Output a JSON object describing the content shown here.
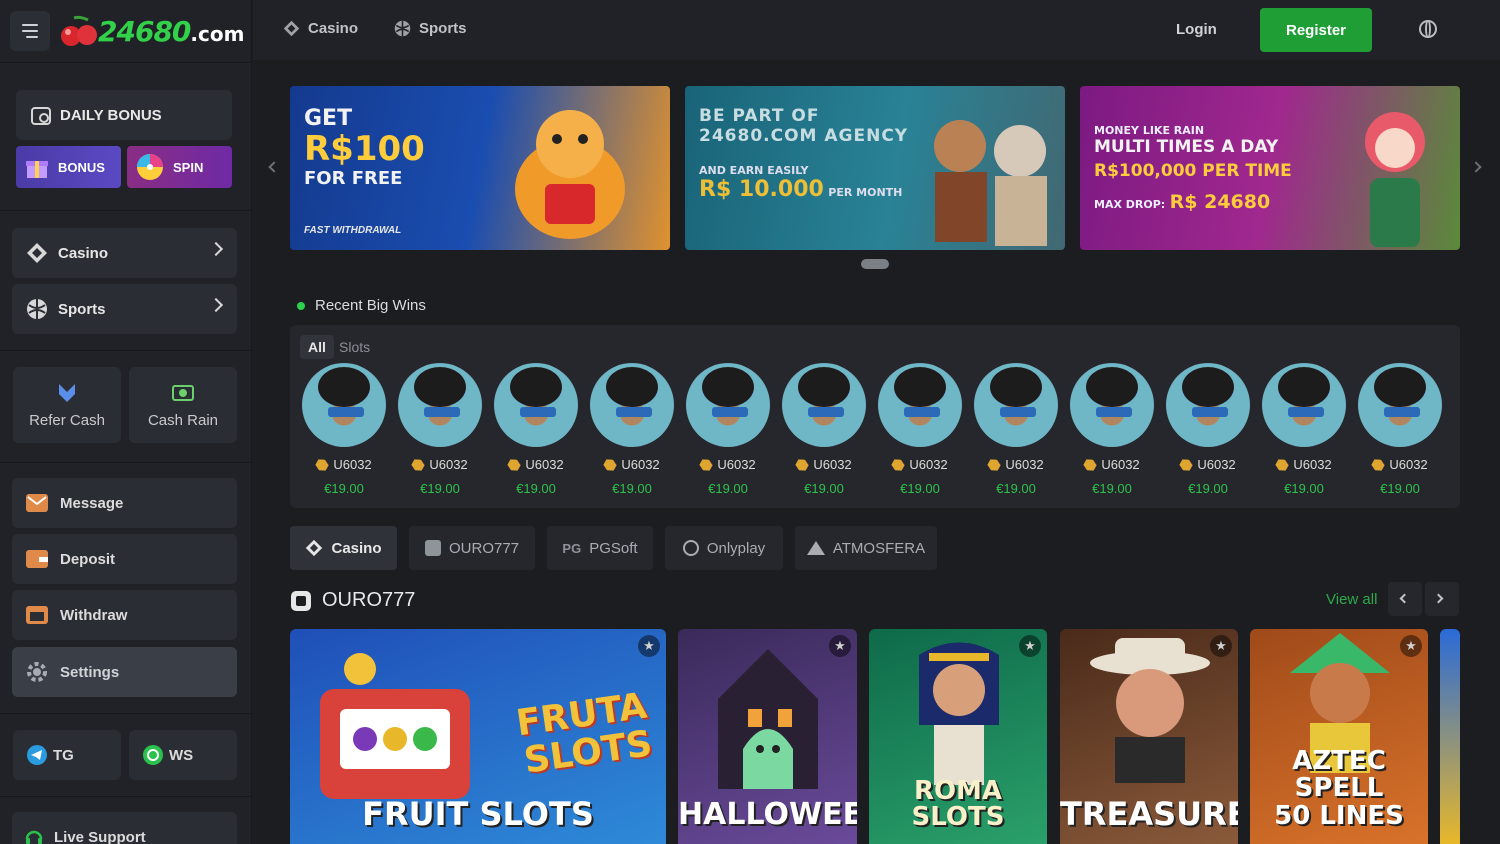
{
  "logo": {
    "text": "24680",
    "suffix": ".com"
  },
  "sidebar": {
    "daily_bonus": "DAILY BONUS",
    "bonus": "BONUS",
    "spin": "SPIN",
    "nav": [
      {
        "label": "Casino"
      },
      {
        "label": "Sports"
      }
    ],
    "tiles": [
      {
        "label": "Refer Cash"
      },
      {
        "label": "Cash Rain"
      }
    ],
    "links": [
      {
        "label": "Message"
      },
      {
        "label": "Deposit"
      },
      {
        "label": "Withdraw"
      },
      {
        "label": "Settings"
      }
    ],
    "social": [
      {
        "label": "TG"
      },
      {
        "label": "WS"
      }
    ],
    "live_support": "Live Support"
  },
  "topbar": {
    "casino": "Casino",
    "sports": "Sports",
    "login": "Login",
    "register": "Register"
  },
  "banners": [
    {
      "l1": "GET",
      "l2": "R$100",
      "l3": "FOR FREE",
      "l4": "FAST WITHDRAWAL"
    },
    {
      "l1": "BE PART OF",
      "l2": "24680.COM AGENCY",
      "l3": "AND EARN EASILY",
      "l4": "R$ 10.000",
      "l5": "PER MONTH"
    },
    {
      "l1": "MONEY LIKE RAIN",
      "l2": "MULTI TIMES A DAY",
      "l3": "R$100,000 PER TIME",
      "l4": "MAX DROP:",
      "l5": "R$ 24680"
    }
  ],
  "wins": {
    "title": "Recent Big Wins",
    "tabs": [
      "All",
      "Slots"
    ],
    "items": [
      {
        "user": "U6032",
        "amount": "€19.00"
      },
      {
        "user": "U6032",
        "amount": "€19.00"
      },
      {
        "user": "U6032",
        "amount": "€19.00"
      },
      {
        "user": "U6032",
        "amount": "€19.00"
      },
      {
        "user": "U6032",
        "amount": "€19.00"
      },
      {
        "user": "U6032",
        "amount": "€19.00"
      },
      {
        "user": "U6032",
        "amount": "€19.00"
      },
      {
        "user": "U6032",
        "amount": "€19.00"
      },
      {
        "user": "U6032",
        "amount": "€19.00"
      },
      {
        "user": "U6032",
        "amount": "€19.00"
      },
      {
        "user": "U6032",
        "amount": "€19.00"
      },
      {
        "user": "U6032",
        "amount": "€19.00"
      }
    ]
  },
  "providers": [
    "Casino",
    "OURO777",
    "PGSoft",
    "Onlyplay",
    "ATMOSFERA"
  ],
  "section": {
    "title": "OURO777",
    "view_all": "View all"
  },
  "games": [
    {
      "name": "FRUIT SLOTS",
      "brand": "FRUTA SLOTS",
      "color1": "#1f4fb8",
      "color2": "#2e8ad8"
    },
    {
      "name": "HALLOWEEN",
      "color1": "#3a2a5a",
      "color2": "#6a4a9a"
    },
    {
      "name": "ROMA SLOTS",
      "color1": "#0e6a4a",
      "color2": "#2aa06a"
    },
    {
      "name": "TREASURE",
      "color1": "#4a2a1a",
      "color2": "#8a5a3a"
    },
    {
      "name": "AZTEC SPELL 50 LINES",
      "color1": "#a04a1a",
      "color2": "#d8722a"
    }
  ]
}
